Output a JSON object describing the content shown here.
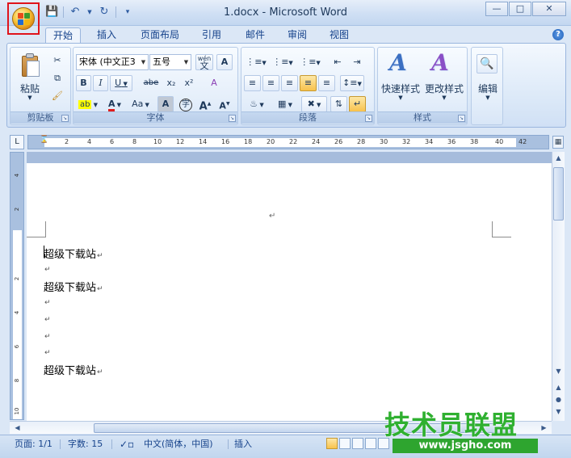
{
  "window": {
    "title": "1.docx - Microsoft Word",
    "min_glyph": "—",
    "max_glyph": "□",
    "close_glyph": "✕"
  },
  "quick_access": {
    "save_icon": "save-icon",
    "undo_icon": "undo-icon",
    "redo_icon": "redo-icon",
    "customize_icon": "customize-icon"
  },
  "tabs": [
    {
      "label": "开始",
      "active": true
    },
    {
      "label": "插入"
    },
    {
      "label": "页面布局"
    },
    {
      "label": "引用"
    },
    {
      "label": "邮件"
    },
    {
      "label": "审阅"
    },
    {
      "label": "视图"
    }
  ],
  "help_glyph": "?",
  "ribbon": {
    "clipboard": {
      "label": "剪贴板",
      "paste": "粘贴"
    },
    "font": {
      "label": "字体",
      "font_name": "宋体 (中文正3",
      "font_size": "五号",
      "phonetic_guide": "wén",
      "char_border": "A",
      "bold": "B",
      "italic": "I",
      "underline": "U",
      "strikethrough": "abe",
      "subscript": "x₂",
      "superscript": "x²",
      "clear_format": "A",
      "font_color": "A",
      "change_case": "Aa",
      "char_shading": "A",
      "enclose_char": "字",
      "grow_font": "A",
      "shrink_font": "A"
    },
    "paragraph": {
      "label": "段落"
    },
    "styles": {
      "label": "样式",
      "quick_styles": "快速样式",
      "change_styles": "更改样式",
      "quick_styles_glyph": "A",
      "change_styles_glyph": "A"
    },
    "editing": {
      "label": "编辑"
    }
  },
  "ruler": {
    "corner": "L",
    "h_numbers": [
      "2",
      "4",
      "6",
      "8",
      "10",
      "12",
      "14",
      "16",
      "18",
      "20",
      "22",
      "24",
      "26",
      "28",
      "30",
      "32",
      "34",
      "36",
      "38",
      "40",
      "42"
    ],
    "v_numbers": [
      "4",
      "2",
      "2",
      "4",
      "6",
      "8",
      "10"
    ]
  },
  "document": {
    "lines": [
      {
        "text": "超级下载站"
      },
      {
        "text": ""
      },
      {
        "text": "超级下载站"
      },
      {
        "text": ""
      },
      {
        "text": ""
      },
      {
        "text": ""
      },
      {
        "text": ""
      },
      {
        "text": "超级下载站"
      }
    ],
    "paragraph_mark": "↵"
  },
  "status_bar": {
    "page": "页面: 1/1",
    "word_count": "字数: 15",
    "language": "中文(简体，中国)",
    "insert_mode": "插入"
  },
  "watermark": {
    "logo_text": "技术员联盟",
    "url_text": "www.jsgho.com"
  },
  "colors": {
    "accent": "#15428b",
    "highlight": "#f8c24c",
    "office_button_frame": "#e0131b",
    "watermark_green": "#2fb030"
  }
}
